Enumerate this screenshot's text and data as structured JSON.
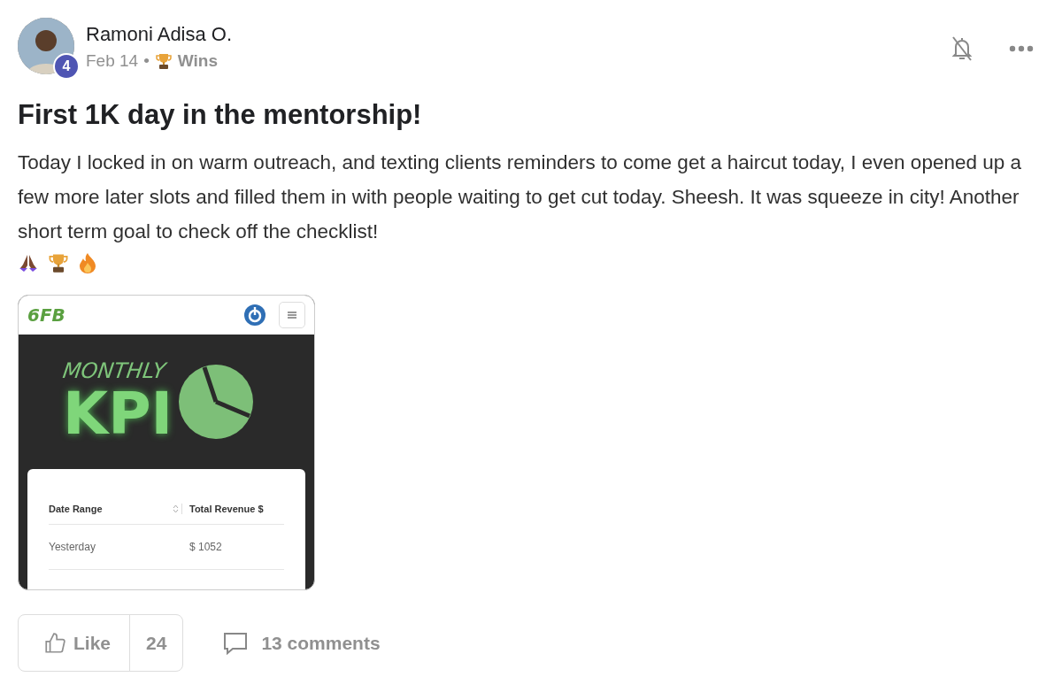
{
  "post": {
    "author": "Ramoni Adisa O.",
    "level_badge": "4",
    "date": "Feb 14",
    "separator": "•",
    "category": "Wins",
    "title": "First 1K day in the mentorship!",
    "body": "Today I locked in on warm outreach, and texting clients reminders to come get a haircut today, I even opened up a few more later slots and filled them in with people waiting to get cut today. Sheesh. It was squeeze in city! Another short term goal to check off the checklist!",
    "attachment": {
      "logo": "6FB",
      "banner_top": "MONTHLY",
      "banner_main": "KPI",
      "table": {
        "columns": [
          "Date Range",
          "Total Revenue $"
        ],
        "rows": [
          [
            "Yesterday",
            "$ 1052"
          ]
        ]
      }
    },
    "like": {
      "label": "Like",
      "count": "24",
      "liked": false
    },
    "comments": "13 comments"
  }
}
